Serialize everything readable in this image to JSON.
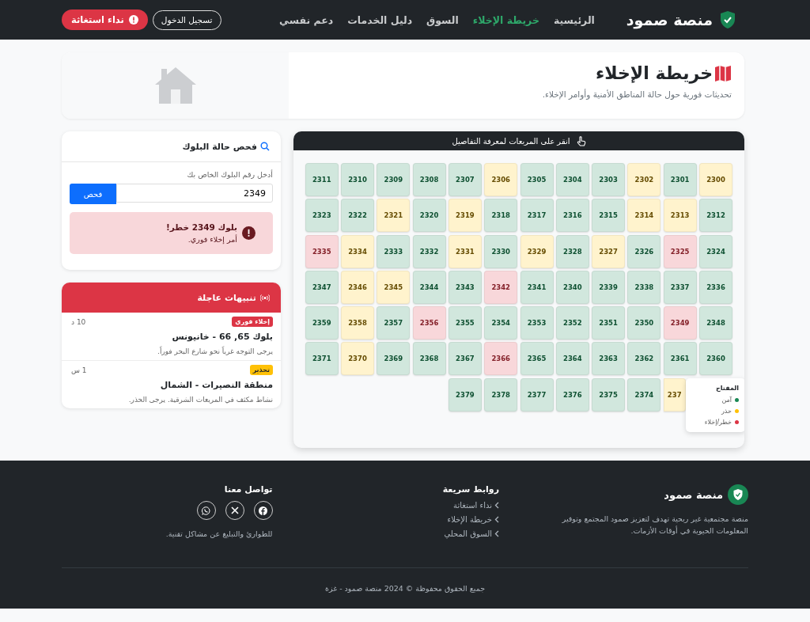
{
  "navbar": {
    "brand": "منصة صمود",
    "links": [
      {
        "label": "الرئيسية",
        "selected": false
      },
      {
        "label": "خريطة الإخلاء",
        "selected": true
      },
      {
        "label": "السوق",
        "selected": false
      },
      {
        "label": "دليل الخدمات",
        "selected": false
      },
      {
        "label": "دعم نفسي",
        "selected": false
      }
    ],
    "login_button": "تسجيل الدخول",
    "sos_button": "نداء استغاثة"
  },
  "hero": {
    "title": "خريطة الإخلاء",
    "subtitle": "تحديثات فورية حول حالة المناطق الأمنية وأوامر الإخلاء.",
    "kind": "picture"
  },
  "map": {
    "hint": "انقر على المربعات لمعرفة التفاصيل",
    "rows": [
      [
        {
          "n": "2300",
          "kind": "warn"
        },
        {
          "n": "2301",
          "kind": "safe"
        },
        {
          "n": "2302",
          "kind": "warn"
        },
        {
          "n": "2303",
          "kind": "safe"
        },
        {
          "n": "2304",
          "kind": "safe"
        },
        {
          "n": "2305",
          "kind": "safe"
        },
        {
          "n": "2306",
          "kind": "warn"
        },
        {
          "n": "2307",
          "kind": "safe"
        },
        {
          "n": "2308",
          "kind": "safe"
        },
        {
          "n": "2309",
          "kind": "safe"
        },
        {
          "n": "2310",
          "kind": "safe"
        },
        {
          "n": "2311",
          "kind": "safe"
        }
      ],
      [
        {
          "n": "2312",
          "kind": "safe"
        },
        {
          "n": "2313",
          "kind": "warn"
        },
        {
          "n": "2314",
          "kind": "warn"
        },
        {
          "n": "2315",
          "kind": "safe"
        },
        {
          "n": "2316",
          "kind": "safe"
        },
        {
          "n": "2317",
          "kind": "safe"
        },
        {
          "n": "2318",
          "kind": "safe"
        },
        {
          "n": "2319",
          "kind": "warn"
        },
        {
          "n": "2320",
          "kind": "safe"
        },
        {
          "n": "2321",
          "kind": "warn"
        },
        {
          "n": "2322",
          "kind": "safe"
        },
        {
          "n": "2323",
          "kind": "safe"
        }
      ],
      [
        {
          "n": "2324",
          "kind": "safe"
        },
        {
          "n": "2325",
          "kind": "danger"
        },
        {
          "n": "2326",
          "kind": "safe"
        },
        {
          "n": "2327",
          "kind": "warn"
        },
        {
          "n": "2328",
          "kind": "safe"
        },
        {
          "n": "2329",
          "kind": "warn"
        },
        {
          "n": "2330",
          "kind": "safe"
        },
        {
          "n": "2331",
          "kind": "warn"
        },
        {
          "n": "2332",
          "kind": "safe"
        },
        {
          "n": "2333",
          "kind": "safe"
        },
        {
          "n": "2334",
          "kind": "warn"
        },
        {
          "n": "2335",
          "kind": "danger"
        }
      ],
      [
        {
          "n": "2336",
          "kind": "safe"
        },
        {
          "n": "2337",
          "kind": "safe"
        },
        {
          "n": "2338",
          "kind": "safe"
        },
        {
          "n": "2339",
          "kind": "safe"
        },
        {
          "n": "2340",
          "kind": "safe"
        },
        {
          "n": "2341",
          "kind": "safe"
        },
        {
          "n": "2342",
          "kind": "danger"
        },
        {
          "n": "2343",
          "kind": "safe"
        },
        {
          "n": "2344",
          "kind": "safe"
        },
        {
          "n": "2345",
          "kind": "warn"
        },
        {
          "n": "2346",
          "kind": "warn"
        },
        {
          "n": "2347",
          "kind": "safe"
        }
      ],
      [
        {
          "n": "2348",
          "kind": "safe"
        },
        {
          "n": "2349",
          "kind": "danger"
        },
        {
          "n": "2350",
          "kind": "safe"
        },
        {
          "n": "2351",
          "kind": "safe"
        },
        {
          "n": "2352",
          "kind": "safe"
        },
        {
          "n": "2353",
          "kind": "safe"
        },
        {
          "n": "2354",
          "kind": "safe"
        },
        {
          "n": "2355",
          "kind": "safe"
        },
        {
          "n": "2356",
          "kind": "danger"
        },
        {
          "n": "2357",
          "kind": "safe"
        },
        {
          "n": "2358",
          "kind": "warn"
        },
        {
          "n": "2359",
          "kind": "safe"
        }
      ],
      [
        {
          "n": "2360",
          "kind": "safe"
        },
        {
          "n": "2361",
          "kind": "safe"
        },
        {
          "n": "2362",
          "kind": "safe"
        },
        {
          "n": "2363",
          "kind": "safe"
        },
        {
          "n": "2364",
          "kind": "safe"
        },
        {
          "n": "2365",
          "kind": "safe"
        },
        {
          "n": "2366",
          "kind": "danger"
        },
        {
          "n": "2367",
          "kind": "safe"
        },
        {
          "n": "2368",
          "kind": "safe"
        },
        {
          "n": "2369",
          "kind": "safe"
        },
        {
          "n": "2370",
          "kind": "warn"
        },
        {
          "n": "2371",
          "kind": "safe"
        }
      ],
      [
        "",
        {
          "n": "237",
          "kind": "warn"
        },
        {
          "n": "2374",
          "kind": "safe"
        },
        {
          "n": "2375",
          "kind": "safe"
        },
        {
          "n": "2376",
          "kind": "safe"
        },
        {
          "n": "2377",
          "kind": "safe"
        },
        {
          "n": "2378",
          "kind": "safe"
        },
        {
          "n": "2379",
          "kind": "safe"
        }
      ]
    ],
    "legend": {
      "title": "المفتاح",
      "items": [
        {
          "label": "آمن",
          "color": "#198754"
        },
        {
          "label": "حذر",
          "color": "#ffc107"
        },
        {
          "label": "خطر/إخلاء",
          "color": "#dc3545"
        }
      ]
    }
  },
  "check": {
    "title": "فحص حالة البلوك",
    "label": "أدخل رقم البلوك الخاص بك",
    "value": "2349",
    "button": "فحص",
    "result": {
      "kind": "danger",
      "title": "بلوك 2349 خطر!",
      "text": "أمر إخلاء فوري."
    }
  },
  "alerts": {
    "title": "تنبيهات عاجلة",
    "items": [
      {
        "badge": "إخلاء فوري",
        "kind": "urgent",
        "time": "10 د",
        "title": "بلوك 65, 66 - خانيونس",
        "text": "يرجى التوجه غرباً نحو شارع البحر فوراً."
      },
      {
        "badge": "تحذير",
        "kind": "warning",
        "time": "1 س",
        "title": "منطقة النصيرات - الشمال",
        "text": "نشاط مكثف في المربعات الشرقية. يرجى الحذر."
      }
    ]
  },
  "footer": {
    "brand": "منصة صمود",
    "description": "منصة مجتمعية غير ربحية تهدف لتعزيز صمود المجتمع وتوفير المعلومات الحيوية في أوقات الأزمات.",
    "links_title": "روابط سريعة",
    "links": [
      "نداء استغاثة",
      "خريطة الإخلاء",
      "السوق المحلي"
    ],
    "contact_title": "تواصل معنا",
    "contact_text": "للطوارئ والتبليغ عن مشاكل تقنية.",
    "copyright": "جميع الحقوق محفوظة © 2024 منصة صمود - غزة"
  }
}
